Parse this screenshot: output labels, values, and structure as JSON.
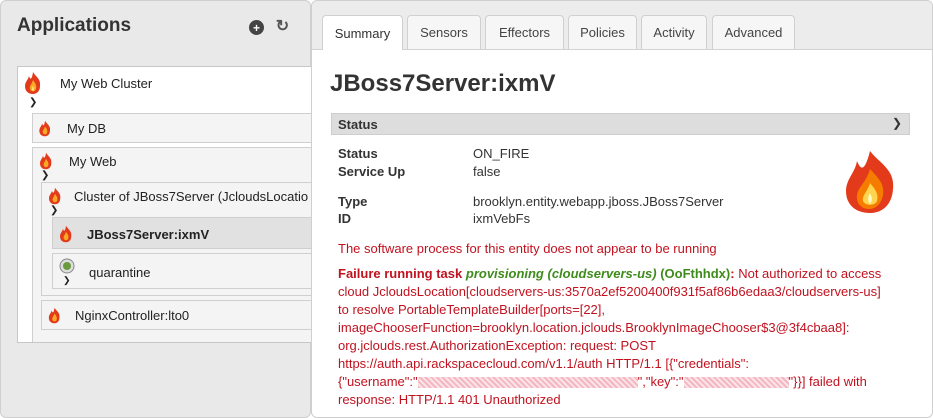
{
  "left": {
    "title": "Applications",
    "add_icon": "plus-icon",
    "refresh_icon": "refresh-icon",
    "tree": {
      "root": {
        "label": "My Web Cluster",
        "icon": "fire-icon"
      },
      "my_db": {
        "label": "My DB",
        "icon": "fire-icon"
      },
      "my_web": {
        "label": "My Web",
        "icon": "fire-icon"
      },
      "cluster": {
        "label": "Cluster of JBoss7Server (JcloudsLocatio",
        "icon": "fire-icon"
      },
      "jboss": {
        "label": "JBoss7Server:ixmV",
        "icon": "fire-icon"
      },
      "quarantine": {
        "label": "quarantine",
        "icon": "stopped-icon"
      },
      "nginx": {
        "label": "NginxController:lto0",
        "icon": "fire-icon"
      }
    }
  },
  "tabs": [
    {
      "label": "Summary"
    },
    {
      "label": "Sensors"
    },
    {
      "label": "Effectors"
    },
    {
      "label": "Policies"
    },
    {
      "label": "Activity"
    },
    {
      "label": "Advanced"
    }
  ],
  "entity": {
    "title": "JBoss7Server:ixmV",
    "section_label": "Status",
    "fields": {
      "status_key": "Status",
      "status_val": "ON_FIRE",
      "service_up_key": "Service Up",
      "service_up_val": "false",
      "type_key": "Type",
      "type_val": "brooklyn.entity.webapp.jboss.JBoss7Server",
      "id_key": "ID",
      "id_val": "ixmVebFs"
    },
    "not_running_msg": "The software process for this entity does not appear to be running",
    "failure": {
      "prefix": "Failure running task",
      "task": "provisioning (cloudservers-us)",
      "task_id": "(OoFthhdx)",
      "colon": ":",
      "line1_rest": "Not authorized to access",
      "line2": "cloud JcloudsLocation[cloudservers-us:3570a2ef5200400f931f5af86b6edaa3/cloudservers-us]",
      "line3": "to resolve PortableTemplateBuilder[ports=[22],",
      "line4": "imageChooserFunction=brooklyn.location.jclouds.BrooklynImageChooser$3@3f4cbaa8]:",
      "line5": "org.jclouds.rest.AuthorizationException: request: POST",
      "line6": "https://auth.api.rackspacecloud.com/v1.1/auth HTTP/1.1 [{\"credentials\":",
      "line7a": "{\"username\":\"",
      "line7b": "\",\"key\":\"",
      "line7c": "\"}}] failed with",
      "line8": "response: HTTP/1.1 401 Unauthorized"
    },
    "status_icon": "fire-icon"
  },
  "colors": {
    "error": "#c1121f",
    "task": "#3e8c1c"
  }
}
